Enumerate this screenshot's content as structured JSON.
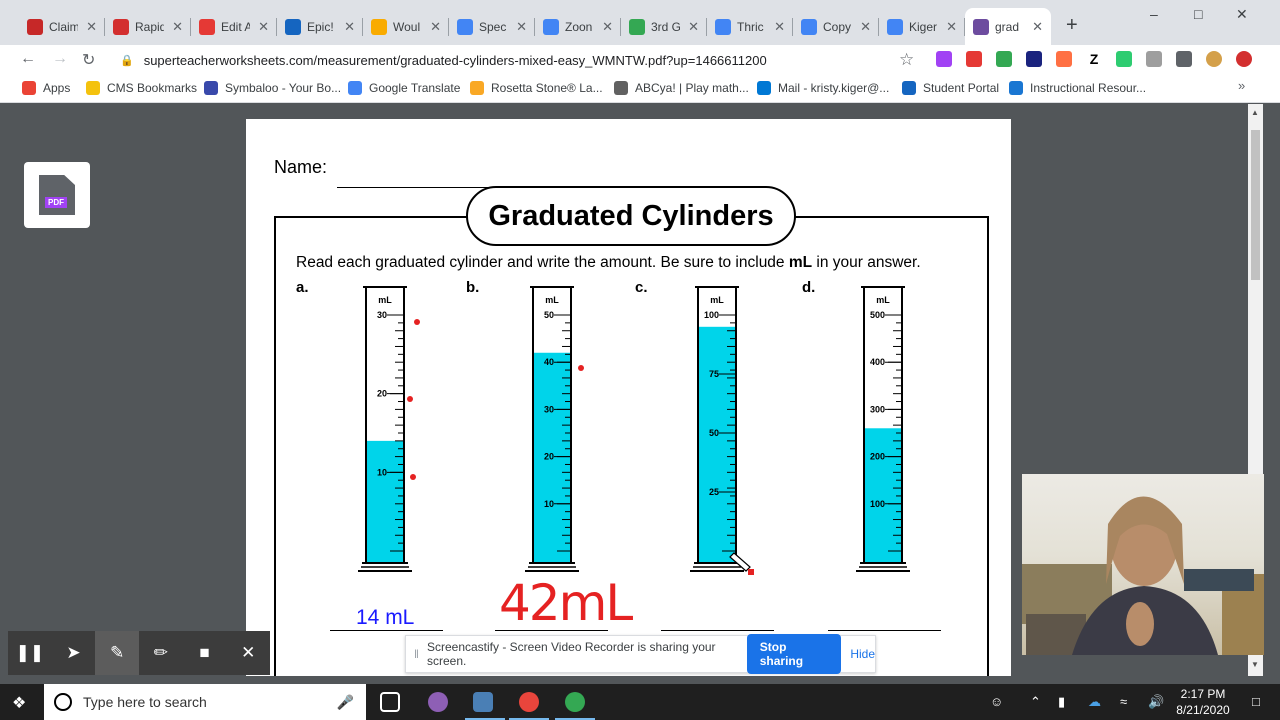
{
  "browser": {
    "tabs": [
      {
        "title": "Claim",
        "icon_color": "#c62828",
        "icon": "nc-icon"
      },
      {
        "title": "Rapid",
        "icon_color": "#d32f2f",
        "icon": "rapid-icon"
      },
      {
        "title": "Edit A",
        "icon_color": "#e53935",
        "icon": "edit-icon"
      },
      {
        "title": "Epic!",
        "icon_color": "#1565c0",
        "icon": "epic-icon"
      },
      {
        "title": "Woul",
        "icon_color": "#f9ab00",
        "icon": "slides-icon"
      },
      {
        "title": "Spec",
        "icon_color": "#4285f4",
        "icon": "docs-icon"
      },
      {
        "title": "Zoon",
        "icon_color": "#4285f4",
        "icon": "docs-icon"
      },
      {
        "title": "3rd G",
        "icon_color": "#34a853",
        "icon": "drive-icon"
      },
      {
        "title": "Thric",
        "icon_color": "#4285f4",
        "icon": "docs-icon"
      },
      {
        "title": "Copy",
        "icon_color": "#4285f4",
        "icon": "docs-icon"
      },
      {
        "title": "Kiger",
        "icon_color": "#4285f4",
        "icon": "docs-icon"
      },
      {
        "title": "grad",
        "icon_color": "#6d4c9f",
        "icon": "superteacher-icon",
        "active": true
      }
    ],
    "url": "superteacherworksheets.com/measurement/graduated-cylinders-mixed-easy_WMNTW.pdf?up=1466611200",
    "bookmarks": [
      {
        "label": "Apps",
        "color": "#ea4335"
      },
      {
        "label": "CMS Bookmarks",
        "color": "#f4c20d"
      },
      {
        "label": "Symbaloo - Your Bo...",
        "color": "#3949ab"
      },
      {
        "label": "Google Translate",
        "color": "#4285f4"
      },
      {
        "label": "Rosetta Stone® La...",
        "color": "#f9a825"
      },
      {
        "label": "ABCya! | Play math...",
        "color": "#616161"
      },
      {
        "label": "Mail - kristy.kiger@...",
        "color": "#0078d4"
      },
      {
        "label": "Student Portal",
        "color": "#1565c0"
      },
      {
        "label": "Instructional Resour...",
        "color": "#1976d2"
      }
    ]
  },
  "worksheet": {
    "name_label": "Name:",
    "title": "Graduated Cylinders",
    "instruction_pre": "Read each graduated cylinder and write the amount.  Be sure to include ",
    "instruction_bold": "mL",
    "instruction_post": " in your answer.",
    "unit": "mL",
    "pdf_label": "PDF",
    "cylinders": [
      {
        "letter": "a.",
        "max": 30,
        "labels": [
          "30",
          "20",
          "10"
        ],
        "fill": 14
      },
      {
        "letter": "b.",
        "max": 50,
        "labels": [
          "50",
          "40",
          "30",
          "20",
          "10"
        ],
        "fill": 42
      },
      {
        "letter": "c.",
        "max": 100,
        "labels": [
          "100",
          "75",
          "50",
          "25"
        ],
        "fill": 95
      },
      {
        "letter": "d.",
        "max": 500,
        "labels": [
          "500",
          "400",
          "300",
          "200",
          "100"
        ],
        "fill": 260
      }
    ],
    "answers": [
      "14 mL",
      "42mL",
      "",
      ""
    ],
    "liquid_color": "#00d4ea",
    "marker_color": "#e52222"
  },
  "screencastify": {
    "message": "Screencastify - Screen Video Recorder is sharing your screen.",
    "stop_label": "Stop sharing",
    "hide_label": "Hide"
  },
  "taskbar": {
    "search_placeholder": "Type here to search",
    "time": "2:17 PM",
    "date": "8/21/2020"
  }
}
